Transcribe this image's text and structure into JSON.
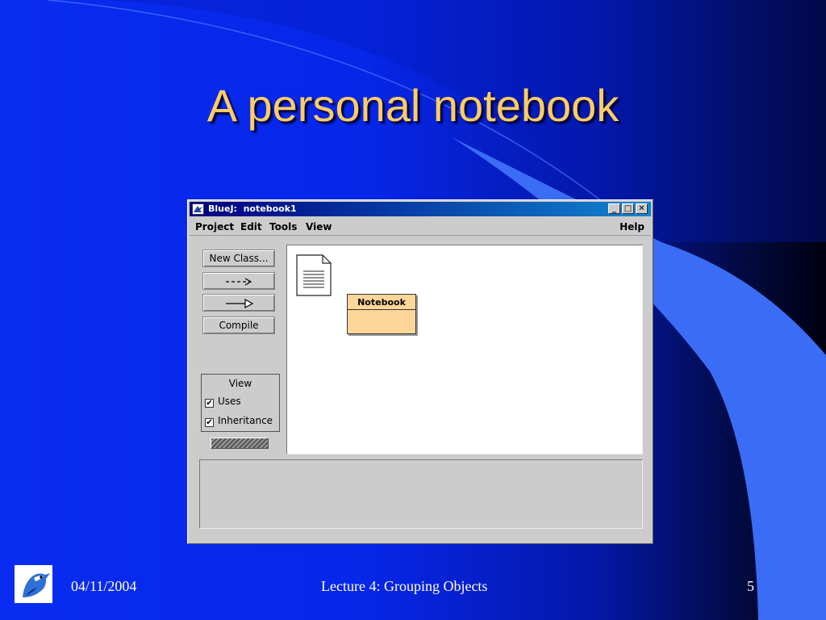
{
  "slide": {
    "title": "A personal notebook"
  },
  "window": {
    "title": "BlueJ:  notebook1",
    "controls": [
      "_",
      "□",
      "✕"
    ]
  },
  "menu": {
    "items": [
      "Project",
      "Edit",
      "Tools",
      "View"
    ],
    "help": "Help"
  },
  "toolbar": {
    "new_class_label": "New Class...",
    "uses_arrow_label": "--->",
    "compile_label": "Compile"
  },
  "view_panel": {
    "title": "View",
    "uses_label": "Uses",
    "uses_checked": true,
    "inheritance_label": "Inheritance",
    "inheritance_checked": true
  },
  "diagram": {
    "classes": [
      {
        "name": "Notebook",
        "color": "#ffd699"
      }
    ],
    "readme_icon": "document-icon"
  },
  "footer": {
    "date": "04/11/2004",
    "lecture": "Lecture 4: Grouping Objects",
    "page": "5"
  },
  "colors": {
    "title_color": "#ffcc66",
    "background": "#0a2cf0",
    "class_fill": "#ffd699",
    "window_gray": "#cccccc"
  }
}
